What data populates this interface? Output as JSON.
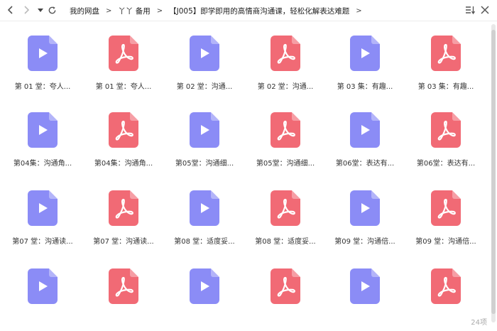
{
  "breadcrumb": [
    "我的网盘",
    "丫丫 备用",
    "【J005】即学即用的高情商沟通课，轻松化解表达难题"
  ],
  "breadcrumb_sep": ">",
  "colors": {
    "video": "#8b8cf6",
    "pdf": "#f16a75"
  },
  "files": [
    {
      "name": "第 01 堂：夸人...",
      "type": "video",
      "icon": "play-icon"
    },
    {
      "name": "第 01 堂：夸人...",
      "type": "pdf",
      "icon": "pdf-icon"
    },
    {
      "name": "第 02 堂：沟通...",
      "type": "video",
      "icon": "play-icon"
    },
    {
      "name": "第 02 堂：沟通...",
      "type": "pdf",
      "icon": "pdf-icon"
    },
    {
      "name": "第 03 集：有趣...",
      "type": "video",
      "icon": "play-icon"
    },
    {
      "name": "第 03 集：有趣...",
      "type": "pdf",
      "icon": "pdf-icon"
    },
    {
      "name": "第04集：沟通角...",
      "type": "video",
      "icon": "play-icon"
    },
    {
      "name": "第04集：沟通角...",
      "type": "pdf",
      "icon": "pdf-icon"
    },
    {
      "name": "第05堂：沟通细...",
      "type": "video",
      "icon": "play-icon"
    },
    {
      "name": "第05堂：沟通细...",
      "type": "pdf",
      "icon": "pdf-icon"
    },
    {
      "name": "第06堂：表达有...",
      "type": "video",
      "icon": "play-icon"
    },
    {
      "name": "第06堂：表达有...",
      "type": "pdf",
      "icon": "pdf-icon"
    },
    {
      "name": "第07 堂：沟通读...",
      "type": "video",
      "icon": "play-icon"
    },
    {
      "name": "第07 堂：沟通读...",
      "type": "pdf",
      "icon": "pdf-icon"
    },
    {
      "name": "第08 堂：适度妥...",
      "type": "video",
      "icon": "play-icon"
    },
    {
      "name": "第08 堂：适度妥...",
      "type": "pdf",
      "icon": "pdf-icon"
    },
    {
      "name": "第09 堂：沟通倍...",
      "type": "video",
      "icon": "play-icon"
    },
    {
      "name": "第09 堂：沟通倍...",
      "type": "pdf",
      "icon": "pdf-icon"
    },
    {
      "name": "",
      "type": "video",
      "icon": "play-icon"
    },
    {
      "name": "",
      "type": "pdf",
      "icon": "pdf-icon"
    },
    {
      "name": "",
      "type": "video",
      "icon": "play-icon"
    },
    {
      "name": "",
      "type": "pdf",
      "icon": "pdf-icon"
    },
    {
      "name": "",
      "type": "video",
      "icon": "play-icon"
    },
    {
      "name": "",
      "type": "pdf",
      "icon": "pdf-icon"
    }
  ],
  "item_count": "24项"
}
